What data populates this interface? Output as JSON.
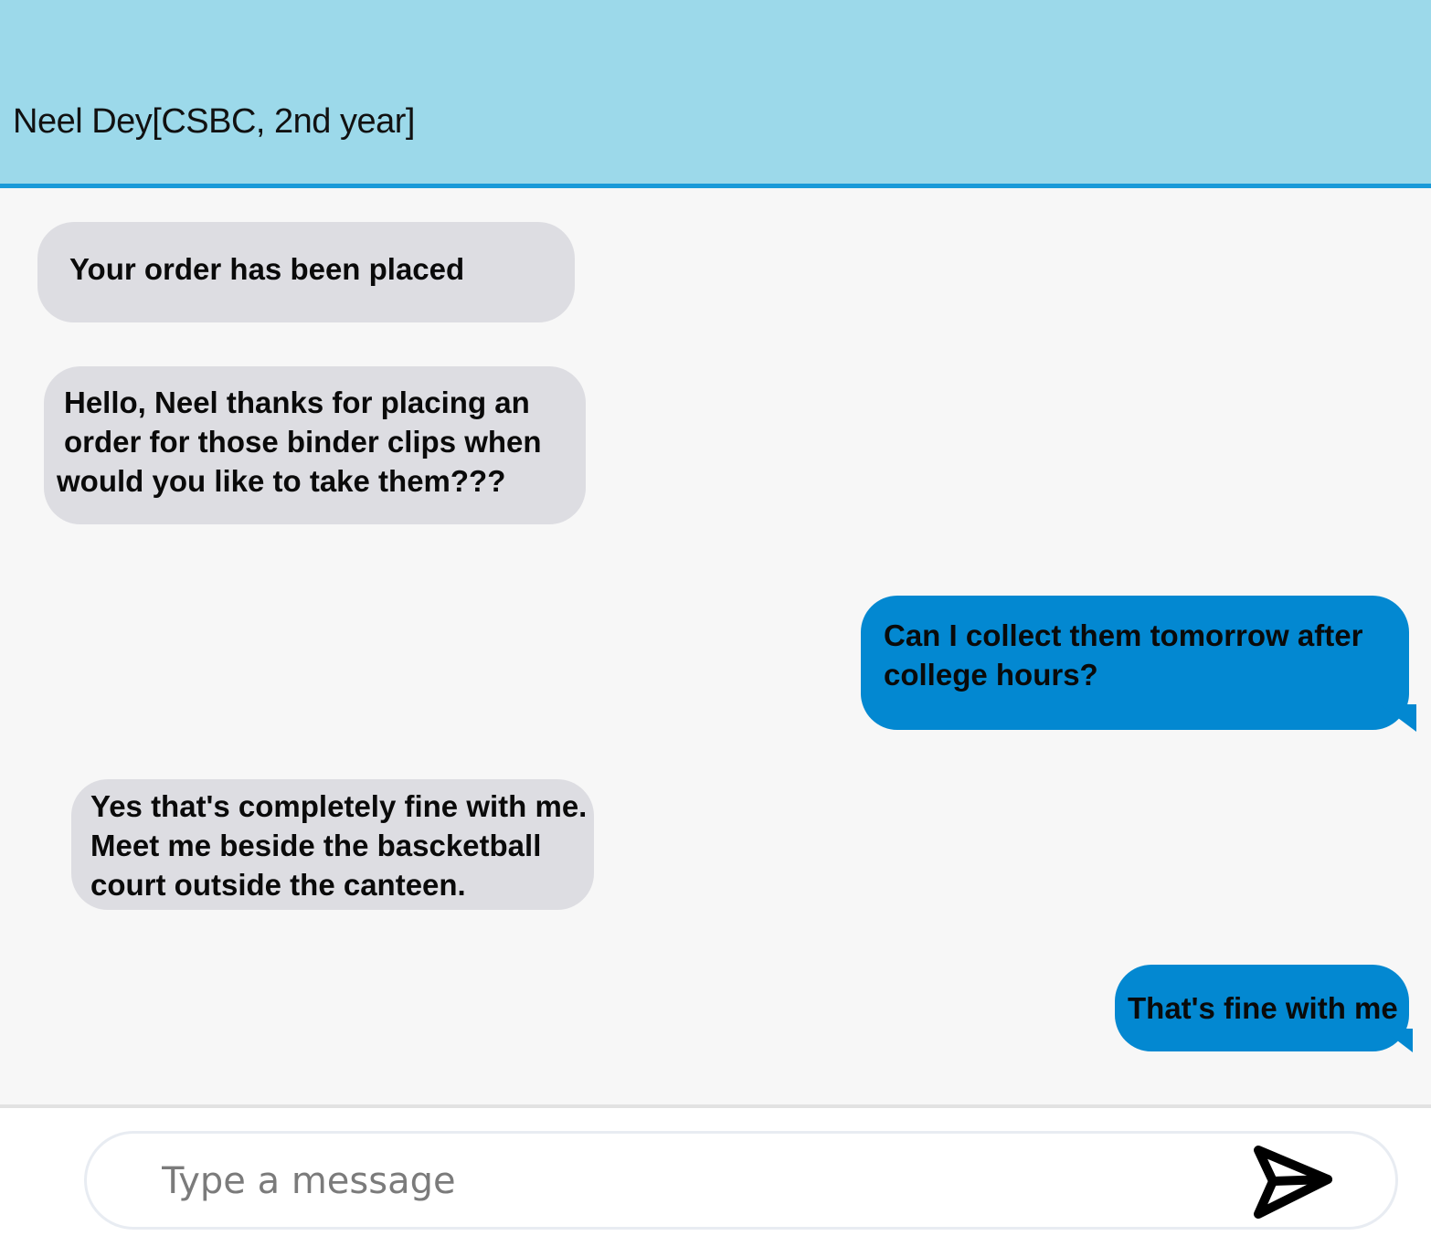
{
  "header": {
    "contact_name": "Neel Dey[CSBC, 2nd year]",
    "background_color": "#9cd9ea",
    "accent_color": "#1a9ad8"
  },
  "messages": [
    {
      "direction": "incoming",
      "lines": [
        "Your order has been placed"
      ]
    },
    {
      "direction": "incoming",
      "lines": [
        "Hello, Neel thanks for placing an",
        "order for those binder clips when",
        "would you like to take them???"
      ]
    },
    {
      "direction": "outgoing",
      "lines": [
        "Can I collect them tomorrow after",
        "college hours?"
      ]
    },
    {
      "direction": "incoming",
      "lines": [
        "Yes that's completely fine with me.",
        "Meet me beside the bascketball",
        "court outside the canteen."
      ]
    },
    {
      "direction": "outgoing",
      "lines": [
        "That's fine with me"
      ]
    }
  ],
  "colors": {
    "incoming_bubble": "#dddde2",
    "outgoing_bubble": "#0388d1"
  },
  "composer": {
    "placeholder": "Type a message",
    "value": "",
    "send_icon": "send-arrow-icon"
  }
}
